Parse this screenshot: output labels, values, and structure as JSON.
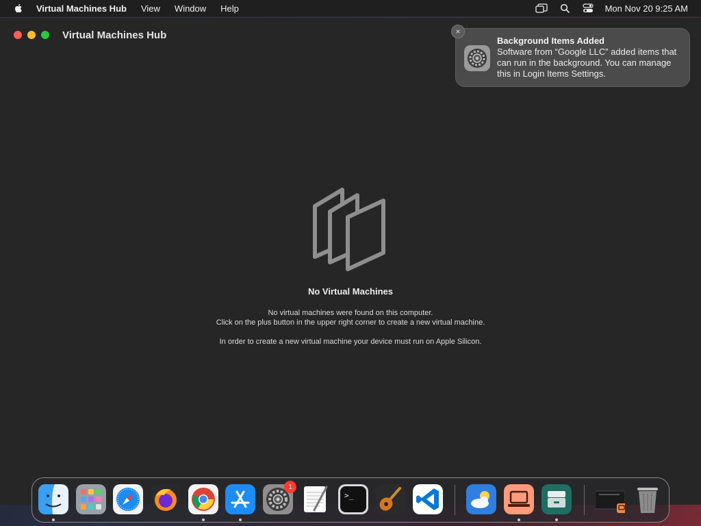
{
  "menubar": {
    "app_name": "Virtual Machines Hub",
    "items": [
      "View",
      "Window",
      "Help"
    ],
    "clock": "Mon Nov 20  9:25 AM"
  },
  "window": {
    "title": "Virtual Machines Hub"
  },
  "empty_state": {
    "title": "No Virtual Machines",
    "line1": "No virtual machines were found on this computer.",
    "line2": "Click on the plus button in the upper right corner to create a new virtual machine.",
    "line3": "In order to create a new virtual machine your device must run on Apple Silicon."
  },
  "notification": {
    "title": "Background Items Added",
    "body": "Software from “Google LLC” added items that can run in the background. You can manage this in Login Items Settings.",
    "close_glyph": "×"
  },
  "dock": {
    "apps": [
      {
        "name": "Finder",
        "icon": "finder-icon",
        "running": true
      },
      {
        "name": "Launchpad",
        "icon": "launchpad-icon",
        "running": false
      },
      {
        "name": "Safari",
        "icon": "safari-icon",
        "running": false
      },
      {
        "name": "Firefox",
        "icon": "firefox-icon",
        "running": false
      },
      {
        "name": "Google Chrome",
        "icon": "chrome-icon",
        "running": true
      },
      {
        "name": "App Store",
        "icon": "app-store-icon",
        "running": true
      },
      {
        "name": "System Settings",
        "icon": "settings-icon",
        "running": false,
        "badge": "1"
      },
      {
        "name": "TextEdit",
        "icon": "textedit-icon",
        "running": false
      },
      {
        "name": "Terminal",
        "icon": "terminal-icon",
        "running": false
      },
      {
        "name": "GarageBand",
        "icon": "guitar-icon",
        "running": false
      },
      {
        "name": "Visual Studio Code",
        "icon": "vscode-icon",
        "running": false
      },
      {
        "name": "Weather",
        "icon": "weather-icon",
        "running": false
      },
      {
        "name": "Virtual Machines Hub",
        "icon": "laptop-icon",
        "running": true
      },
      {
        "name": "Archive Utility",
        "icon": "archive-icon",
        "running": true
      },
      {
        "name": "Downloads",
        "icon": "downloads-stack-icon",
        "running": false
      },
      {
        "name": "Trash",
        "icon": "trash-icon",
        "running": false
      }
    ]
  },
  "colors": {
    "close": "#fe5f57",
    "minimize": "#febc2e",
    "zoom": "#28c840",
    "badge": "#ff3b30"
  }
}
